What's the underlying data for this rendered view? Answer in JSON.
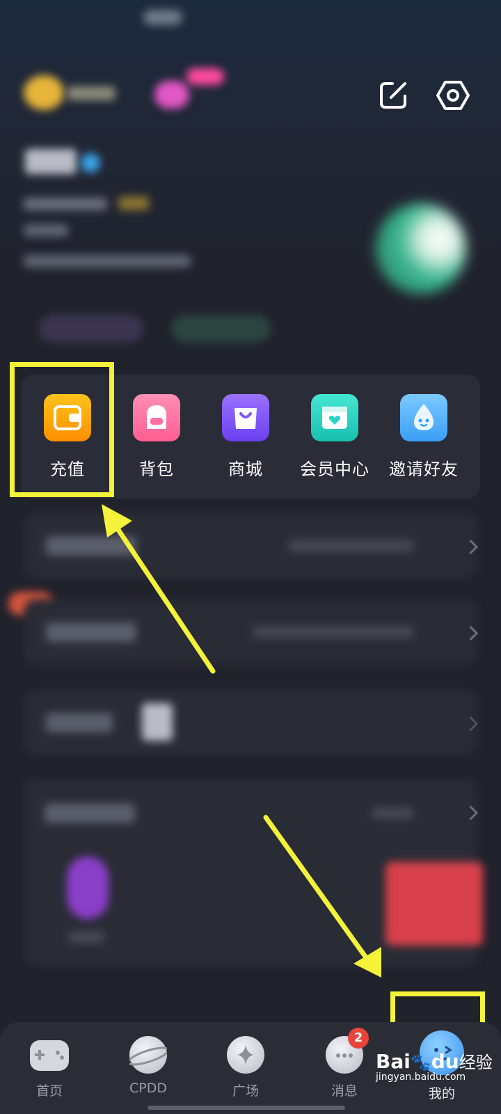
{
  "grid": [
    {
      "label": "充值",
      "icon": "wallet-icon",
      "color": "#ffa200"
    },
    {
      "label": "背包",
      "icon": "backpack-icon",
      "color": "#ff6fa0"
    },
    {
      "label": "商城",
      "icon": "shopping-bag-icon",
      "color": "#7d55f5"
    },
    {
      "label": "会员中心",
      "icon": "vip-card-icon",
      "color": "#27d3c3"
    },
    {
      "label": "邀请好友",
      "icon": "droplet-face-icon",
      "color": "#4cb3ff"
    }
  ],
  "tabs": [
    {
      "label": "首页",
      "icon": "gamepad-icon"
    },
    {
      "label": "CPDD",
      "icon": "planet-icon"
    },
    {
      "label": "广场",
      "icon": "sparkle-icon"
    },
    {
      "label": "消息",
      "icon": "chat-bubble-icon",
      "badge": "2"
    },
    {
      "label": "我的",
      "icon": "avatar-face-icon"
    }
  ],
  "watermark": {
    "brand": "Bai",
    "brand2": "du",
    "suffix": "经验",
    "url": "jingyan.baidu.com"
  },
  "colors": {
    "highlight": "#f4f33a",
    "background": "#20222c",
    "badge": "#e7453b"
  }
}
